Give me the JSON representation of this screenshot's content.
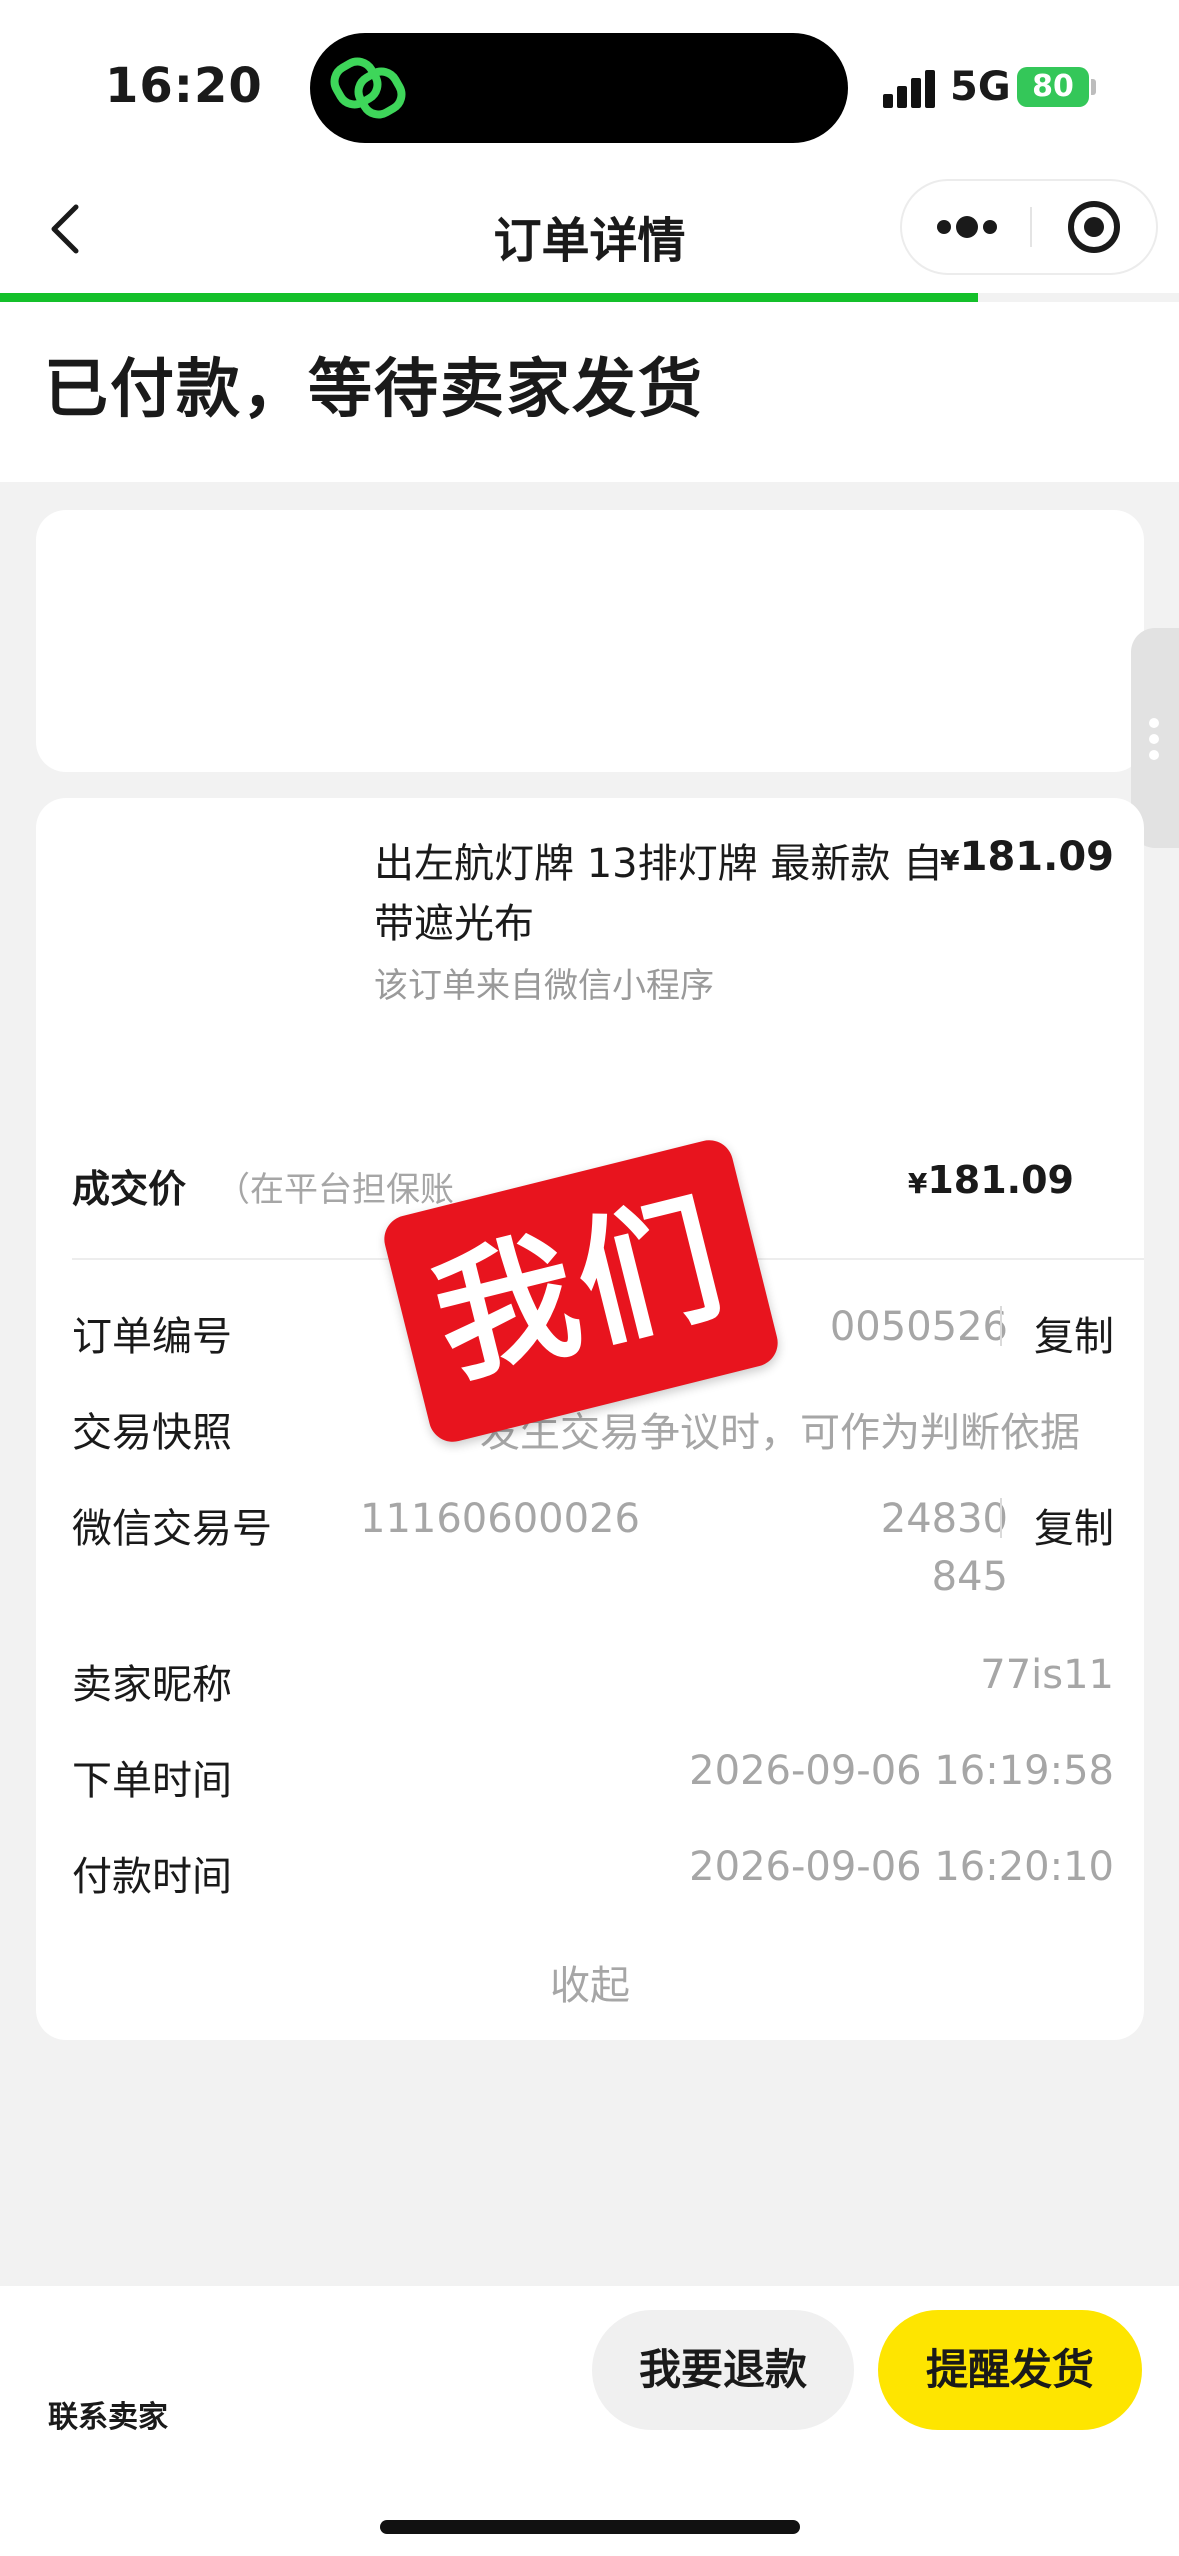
{
  "status_bar": {
    "time": "16:20",
    "network": "5G",
    "battery": "80"
  },
  "navbar": {
    "title": "订单详情"
  },
  "header": {
    "status_title": "已付款，等待卖家发货"
  },
  "product": {
    "name": "出左航灯牌 13排灯牌 最新款 自带遮光布",
    "currency": "¥",
    "price": "181.09",
    "source": "该订单来自微信小程序"
  },
  "deal": {
    "label": "成交价",
    "note": "（在平台担保账",
    "currency": "¥",
    "price": "181.09"
  },
  "details": {
    "order_no": {
      "label": "订单编号",
      "value": "0050526",
      "copy": "复制"
    },
    "snapshot": {
      "label": "交易快照",
      "value": "发生交易争议时，可作为判断依据"
    },
    "wechat_txn": {
      "label": "微信交易号",
      "value_prefix": "11160600026",
      "value_suffix": "24830",
      "value_line2": "845",
      "copy": "复制"
    },
    "seller_nick": {
      "label": "卖家昵称",
      "value": "77is11"
    },
    "order_time": {
      "label": "下单时间",
      "value": "2026-09-06 16:19:58"
    },
    "pay_time": {
      "label": "付款时间",
      "value": "2026-09-06 16:20:10"
    },
    "collapse": "收起"
  },
  "stamp": {
    "text": "我们",
    "color": "#e8141e"
  },
  "bottom_bar": {
    "contact_seller": "联系卖家",
    "refund_button": "我要退款",
    "remind_button": "提醒发货"
  },
  "colors": {
    "progress": "#14c02a",
    "remind_button": "#fee500",
    "battery": "#34c759"
  },
  "icons": {
    "back": "chevron-left-icon",
    "more": "more-dots-icon",
    "close": "target-close-icon",
    "app": "link-rings-icon"
  }
}
